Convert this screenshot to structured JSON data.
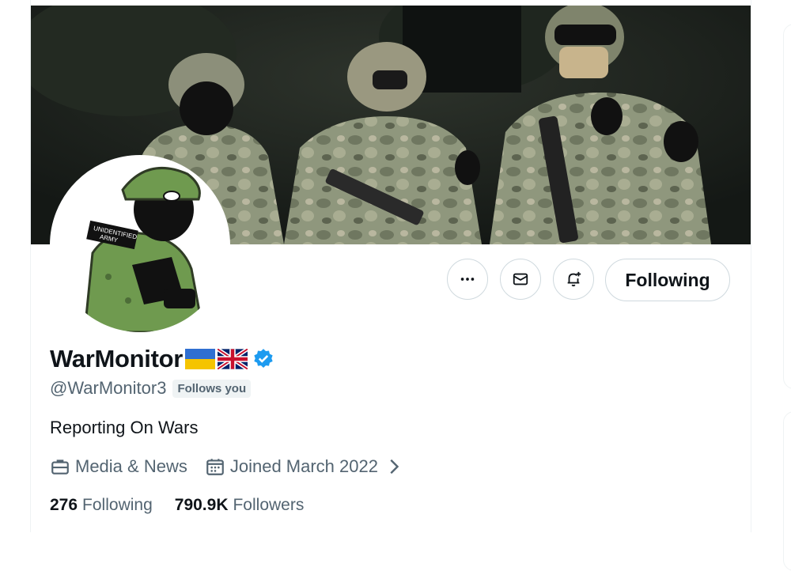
{
  "profile": {
    "display_name": "WarMonitor",
    "flags": [
      "ukraine-flag-icon",
      "uk-flag-icon"
    ],
    "verified_icon": "verified-badge-icon",
    "handle": "@WarMonitor3",
    "follows_you_label": "Follows you",
    "bio": "Reporting On Wars",
    "category": "Media & News",
    "joined": "Joined March 2022",
    "following_count": "276",
    "following_label": "Following",
    "followers_count": "790.9K",
    "followers_label": "Followers",
    "avatar_text": "UNIDENTIFIED ARMY"
  },
  "actions": {
    "more_icon": "more-icon",
    "message_icon": "message-icon",
    "notify_icon": "notify-icon",
    "following_button": "Following"
  },
  "colors": {
    "accent": "#1d9bf0",
    "text_primary": "#0f1419",
    "text_secondary": "#536471",
    "border": "#cfd9de"
  }
}
